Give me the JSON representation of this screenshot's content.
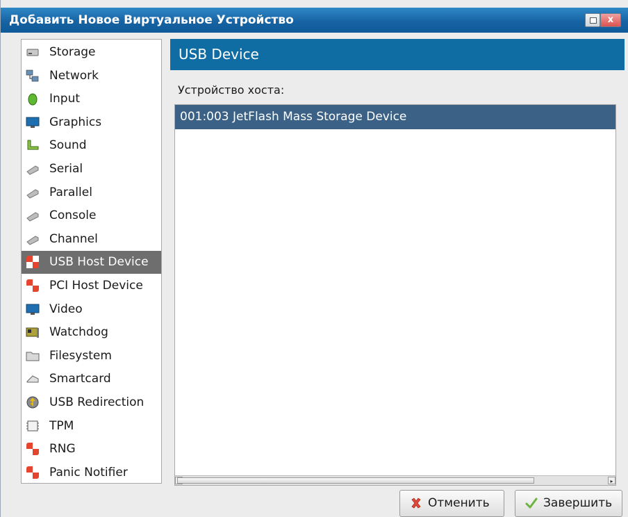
{
  "window": {
    "title": "Добавить Новое Виртуальное Устройство",
    "close_glyph": "x"
  },
  "sidebar": {
    "items": [
      {
        "label": "Storage",
        "icon": "storage-drive-icon"
      },
      {
        "label": "Network",
        "icon": "network-icon"
      },
      {
        "label": "Input",
        "icon": "mouse-icon"
      },
      {
        "label": "Graphics",
        "icon": "monitor-icon"
      },
      {
        "label": "Sound",
        "icon": "sound-card-icon"
      },
      {
        "label": "Serial",
        "icon": "serial-plug-icon"
      },
      {
        "label": "Parallel",
        "icon": "parallel-plug-icon"
      },
      {
        "label": "Console",
        "icon": "console-plug-icon"
      },
      {
        "label": "Channel",
        "icon": "channel-plug-icon"
      },
      {
        "label": "USB Host Device",
        "icon": "usb-host-icon",
        "selected": true
      },
      {
        "label": "PCI Host Device",
        "icon": "pci-host-icon"
      },
      {
        "label": "Video",
        "icon": "video-monitor-icon"
      },
      {
        "label": "Watchdog",
        "icon": "watchdog-card-icon"
      },
      {
        "label": "Filesystem",
        "icon": "folder-icon"
      },
      {
        "label": "Smartcard",
        "icon": "smartcard-reader-icon"
      },
      {
        "label": "USB Redirection",
        "icon": "usb-redirection-icon"
      },
      {
        "label": "TPM",
        "icon": "chip-icon"
      },
      {
        "label": "RNG",
        "icon": "rng-icon"
      },
      {
        "label": "Panic Notifier",
        "icon": "panic-notifier-icon"
      }
    ]
  },
  "main": {
    "header": "USB Device",
    "host_label": "Устройство хоста:",
    "devices": [
      "001:003 JetFlash Mass Storage Device"
    ]
  },
  "buttons": {
    "cancel": "Отменить",
    "finish": "Завершить"
  },
  "colors": {
    "titlebar": "#1763a3",
    "header_band": "#0f6da4",
    "selected_row": "#3b6286",
    "sidebar_selected": "#6e6e6e"
  }
}
